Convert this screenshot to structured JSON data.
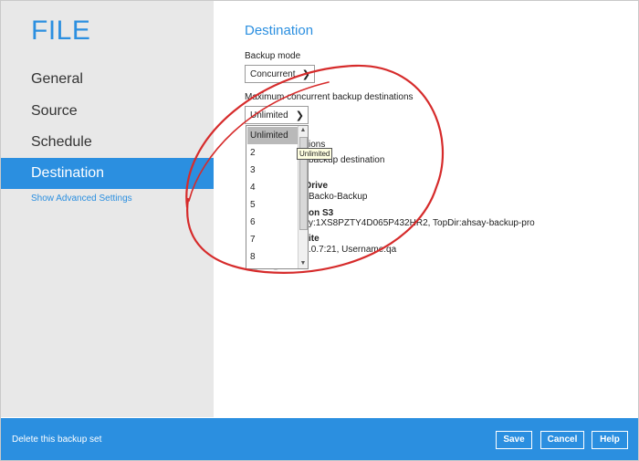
{
  "app": {
    "title": "FILE"
  },
  "sidebar": {
    "items": [
      {
        "label": "General"
      },
      {
        "label": "Source"
      },
      {
        "label": "Schedule"
      },
      {
        "label": "Destination"
      }
    ],
    "advanced_link": "Show Advanced Settings"
  },
  "main": {
    "section_title": "Destination",
    "backup_mode_label": "Backup mode",
    "backup_mode_value": "Concurrent",
    "max_dest_label": "Maximum concurrent backup destinations",
    "max_dest_value": "Unlimited",
    "hidden_rows": [
      {
        "text": "ions"
      },
      {
        "text": "backup destination"
      },
      {
        "text": "Drive"
      },
      {
        "text": "Backo-Backup"
      },
      {
        "text": "on S3"
      },
      {
        "text": "y:1XS8PZTY4D065P432HR2, TopDir:ahsay-backup-pro"
      },
      {
        "text": "ite"
      },
      {
        "text": ".0.7:21, Username:qa"
      }
    ]
  },
  "dropdown": {
    "options": [
      "Unlimited",
      "2",
      "3",
      "4",
      "5",
      "6",
      "7",
      "8"
    ],
    "selected": "Unlimited",
    "tooltip": "Unlimited"
  },
  "footer": {
    "delete_link": "Delete this backup set",
    "save_label": "Save",
    "cancel_label": "Cancel",
    "help_label": "Help"
  },
  "colors": {
    "accent": "#2b8fe0",
    "sidebar_bg": "#e8e8e8",
    "annotation": "#d62b2b"
  },
  "icons": {
    "select_arrow": "chevron-down-icon",
    "scroll_up": "scroll-up-icon",
    "scroll_down": "scroll-down-icon"
  }
}
